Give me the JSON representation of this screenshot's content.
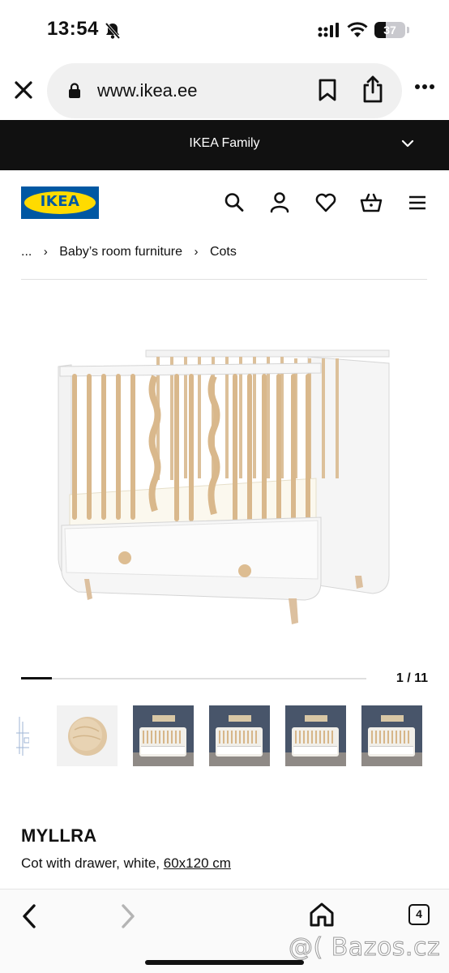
{
  "status_bar": {
    "time": "13:54",
    "battery": "37",
    "battery_level_percent": 37,
    "icons": [
      "bell-slash-icon",
      "signal-icon",
      "wifi-icon",
      "battery-icon"
    ]
  },
  "browser": {
    "url": "www.ikea.ee",
    "icons": [
      "close-icon",
      "lock-icon",
      "bookmark-icon",
      "share-icon",
      "more-icon"
    ]
  },
  "family_bar": {
    "label": "IKEA Family",
    "icon": "chevron-down-icon"
  },
  "header": {
    "logo_text": "IKEA",
    "icons": [
      "search-icon",
      "user-icon",
      "heart-icon",
      "basket-icon",
      "menu-icon"
    ],
    "colors": {
      "logo_blue": "#0058a3",
      "logo_yellow": "#ffdb00"
    }
  },
  "breadcrumb": {
    "ellipsis": "...",
    "items": [
      "Baby’s room furniture",
      "Cots"
    ]
  },
  "gallery": {
    "counter": "1 / 11",
    "progress_fraction": 0.09,
    "thumbnails": [
      "thumbnail-drawing",
      "thumbnail-knob",
      "thumbnail-room-1",
      "thumbnail-room-2",
      "thumbnail-room-3",
      "thumbnail-room-4"
    ]
  },
  "product": {
    "name": "MYLLRA",
    "description": "Cot with drawer, white, ",
    "size": "60x120 cm"
  },
  "bottom_bar": {
    "tabs_count": "4",
    "icons": [
      "back-icon",
      "forward-icon",
      "home-icon",
      "tabs-icon"
    ]
  },
  "watermark": "@( Bazos.cz"
}
